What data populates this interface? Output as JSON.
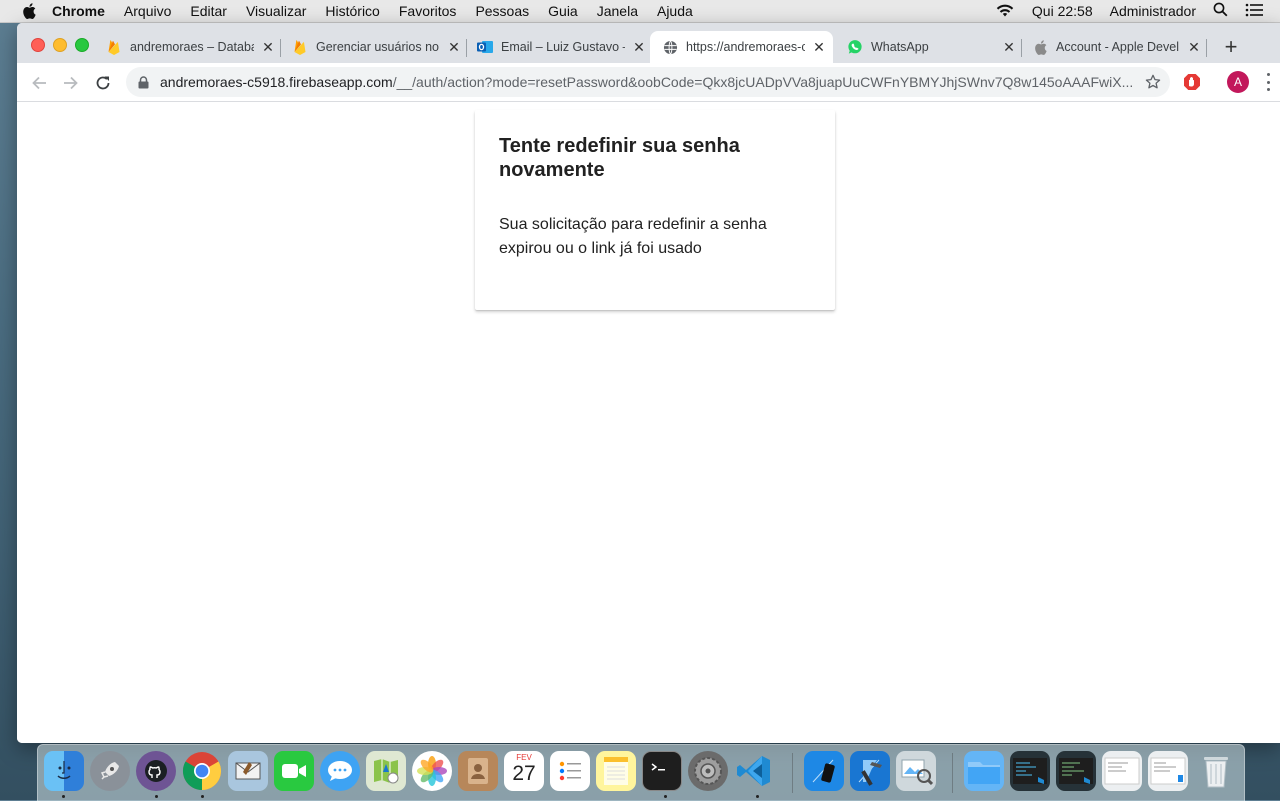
{
  "menubar": {
    "app_name": "Chrome",
    "menus": [
      "Arquivo",
      "Editar",
      "Visualizar",
      "Histórico",
      "Favoritos",
      "Pessoas",
      "Guia",
      "Janela",
      "Ajuda"
    ],
    "clock": "Qui 22:58",
    "user": "Administrador"
  },
  "tabs": [
    {
      "title": "andremoraes – Databa",
      "icon": "firebase-icon"
    },
    {
      "title": "Gerenciar usuários no",
      "icon": "firebase-icon"
    },
    {
      "title": "Email – Luiz Gustavo –",
      "icon": "outlook-icon"
    },
    {
      "title": "https://andremoraes-c",
      "icon": "globe-icon",
      "active": true
    },
    {
      "title": "WhatsApp",
      "icon": "whatsapp-icon"
    },
    {
      "title": "Account - Apple Devel",
      "icon": "apple-icon"
    }
  ],
  "omnibox": {
    "domain": "andremoraes-c5918.firebaseapp.com",
    "path": "/__/auth/action?mode=resetPassword&oobCode=Qkx8jcUADpVVa8juapUuCWFnYBMYJhjSWnv7Q8w145oAAAFwiX..."
  },
  "profile": {
    "initial": "A",
    "color": "#c2185b"
  },
  "card": {
    "title": "Tente redefinir sua senha novamente",
    "message": "Sua solicitação para redefinir a senha expirou ou o link já foi usado"
  },
  "dock": {
    "calendar_month": "FEV",
    "calendar_day": "27"
  }
}
